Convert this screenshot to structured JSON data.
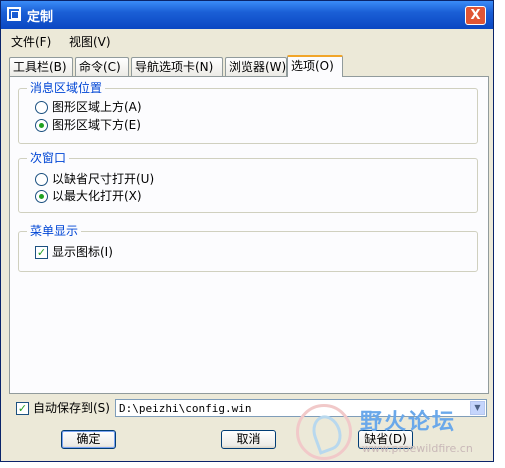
{
  "title": "定制",
  "close_glyph": "X",
  "menu": [
    "文件(F)",
    "视图(V)"
  ],
  "tabs": [
    "工具栏(B)",
    "命令(C)",
    "导航选项卡(N)",
    "浏览器(W)",
    "选项(O)"
  ],
  "active_tab": "选项(O)",
  "groups": {
    "message_area": {
      "legend": "消息区域位置",
      "options": [
        {
          "label": "图形区域上方(A)",
          "selected": false
        },
        {
          "label": "图形区域下方(E)",
          "selected": true
        }
      ]
    },
    "secondary_window": {
      "legend": "次窗口",
      "options": [
        {
          "label": "以缺省尺寸打开(U)",
          "selected": false
        },
        {
          "label": "以最大化打开(X)",
          "selected": true
        }
      ]
    },
    "menu_display": {
      "legend": "菜单显示",
      "checkbox": {
        "label": "显示图标(I)",
        "checked": true
      }
    }
  },
  "autosave": {
    "label": "自动保存到(S)",
    "checked": true,
    "path": "D:\\peizhi\\config.win"
  },
  "buttons": {
    "ok": "确定",
    "cancel": "取消",
    "default": "缺省(D)"
  },
  "watermark": {
    "text": "野火论坛",
    "url": "www.proewildfire.cn"
  },
  "colors": {
    "title_bar": "#0b47c2",
    "legend_text": "#0046d5",
    "active_tab_accent": "#f1a529"
  }
}
